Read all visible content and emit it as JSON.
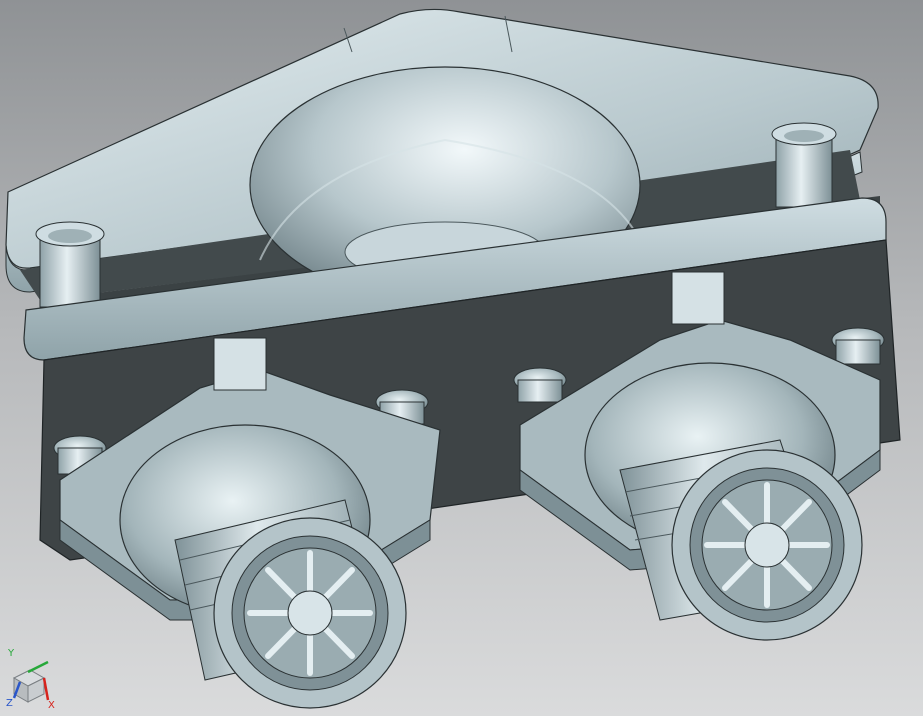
{
  "viewport": {
    "background_top": "#8f9295",
    "background_bottom": "#dadbdc",
    "model_face_light": "#dbe6ea",
    "model_face_mid": "#a9babf",
    "model_face_dark": "#3e4446",
    "model_edge": "#1f2426"
  },
  "triad": {
    "icon": "view-triad-icon",
    "x_label": "X",
    "y_label": "Y",
    "z_label": "Z",
    "x_color": "#d6231c",
    "y_color": "#27a83a",
    "z_color": "#2a56c9"
  }
}
